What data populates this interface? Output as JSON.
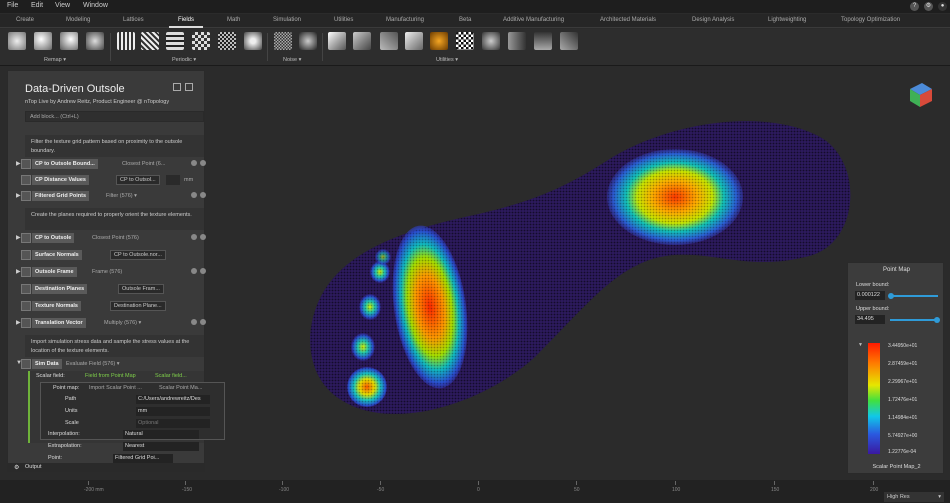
{
  "menu": [
    "File",
    "Edit",
    "View",
    "Window"
  ],
  "tabs": [
    {
      "label": "Create",
      "active": false
    },
    {
      "label": "Modeling",
      "active": false
    },
    {
      "label": "Lattices",
      "active": false
    },
    {
      "label": "Fields",
      "active": true
    },
    {
      "label": "Math",
      "active": false
    },
    {
      "label": "Simulation",
      "active": false
    },
    {
      "label": "Utilities",
      "active": false
    },
    {
      "label": "Manufacturing",
      "active": false
    },
    {
      "label": "Beta",
      "active": false
    },
    {
      "label": "Additive Manufacturing",
      "active": false
    },
    {
      "label": "Architected Materials",
      "active": false
    },
    {
      "label": "Design Analysis",
      "active": false
    },
    {
      "label": "Lightweighting",
      "active": false
    },
    {
      "label": "Topology Optimization",
      "active": false
    }
  ],
  "ribbon_groups": {
    "remap": "Remap ▾",
    "periodic": "Periodic ▾",
    "noise": "Noise ▾",
    "utilities": "Utilities ▾"
  },
  "notebook": {
    "title": "Data-Driven Outsole",
    "subtitle": "nTop Live by Andrew Reitz, Product Engineer @ nTopology",
    "add_block_placeholder": "Add block... (Ctrl+L)",
    "note1": "Filter the texture grid pattern based on proximity to the outsole boundary.",
    "note2": "Create the planes required to properly orient the texture elements.",
    "note3": "Import simulation stress data and sample the stress values at the location of the texture elements.",
    "rows": {
      "cp_boundary": {
        "label": "CP to Outsole Bound...",
        "value": "Closest Point (6..."
      },
      "cp_distance": {
        "label": "CP Distance Values",
        "chip": "CP to Outsol...",
        "unit": "mm"
      },
      "filtered": {
        "label": "Filtered Grid Points",
        "value": "Filter (576) ▾"
      },
      "cp_outsole": {
        "label": "CP to Outsole",
        "value": "Closest Point (576)"
      },
      "surface_normals": {
        "label": "Surface Normals",
        "chip": "CP to Outsole.nor..."
      },
      "outsole_frame": {
        "label": "Outsole Frame",
        "value": "Frame (576)"
      },
      "dest_planes": {
        "label": "Destination Planes",
        "chip": "Outsole Fram..."
      },
      "texture_normals": {
        "label": "Texture Normals",
        "chip": "Destination Plane..."
      },
      "translation": {
        "label": "Translation Vector",
        "value": "Multiply (576) ▾"
      },
      "sim_data": {
        "label": "Sim Data",
        "value": "Evaluate Field (576) ▾"
      },
      "scalar_field": {
        "label": "Scalar field:",
        "value": "Field from Point Map",
        "value2": "Scalar field..."
      },
      "point_map": {
        "label": "Point map:",
        "value": "Import Scalar Point ...",
        "value2": "Scalar Point Ma..."
      },
      "path": {
        "label": "Path",
        "value": "C:/Users/andrewreitz/Des"
      },
      "units": {
        "label": "Units",
        "value": "mm"
      },
      "scale": {
        "label": "Scale",
        "value": "Optional"
      },
      "interp": {
        "label": "Interpolation:",
        "value": "Natural"
      },
      "extrap": {
        "label": "Extrapolation:",
        "value": "Nearest"
      },
      "point": {
        "label": "Point:",
        "value": "Filtered Grid Poi..."
      }
    },
    "output_label": "Output"
  },
  "legend": {
    "title": "Point Map",
    "lower_label": "Lower bound:",
    "lower_value": "0.000122",
    "upper_label": "Upper bound:",
    "upper_value": "34.495",
    "ticks": [
      "3.44950e+01",
      "2.87459e+01",
      "2.29967e+01",
      "1.72476e+01",
      "1.14984e+01",
      "5.74927e+00",
      "1.22776e-04"
    ],
    "footer": "Scalar Point Map_2"
  },
  "ruler": {
    "ticks": [
      "-200 mm",
      "-150",
      "-100",
      "-50",
      "0",
      "50",
      "100",
      "150",
      "200"
    ],
    "quality": "High Res"
  },
  "colors": {
    "accent": "#2f9bd8",
    "hot": "#ff3a00",
    "cold": "#3a1a8a"
  }
}
